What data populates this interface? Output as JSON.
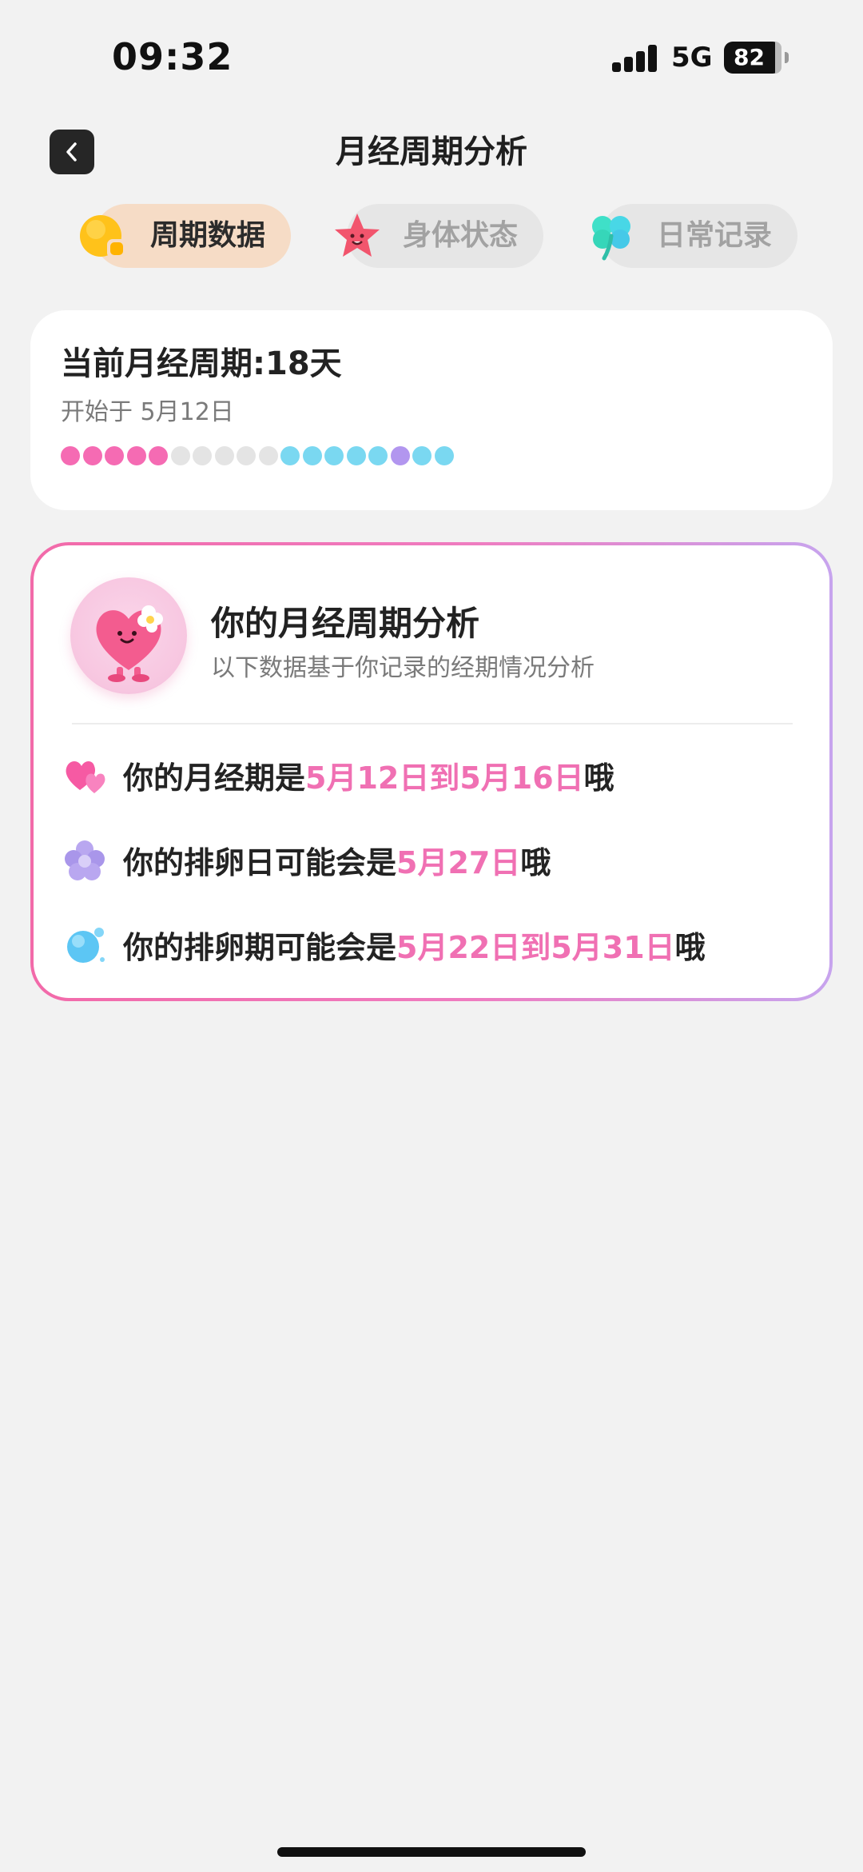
{
  "status_bar": {
    "time": "09:32",
    "network": "5G",
    "battery": "82",
    "signal_bars": 4
  },
  "header": {
    "back_icon": "chevron-left-icon",
    "title": "月经周期分析"
  },
  "tabs": [
    {
      "label": "周期数据",
      "icon": "sun-blob-icon",
      "active": true
    },
    {
      "label": "身体状态",
      "icon": "star-face-icon",
      "active": false
    },
    {
      "label": "日常记录",
      "icon": "clover-icon",
      "active": false
    }
  ],
  "current_cycle": {
    "title": "当前月经周期:18天",
    "start": "开始于 5月12日",
    "day_dots": [
      "period",
      "period",
      "period",
      "period",
      "period",
      "normal",
      "normal",
      "normal",
      "normal",
      "normal",
      "fertile",
      "fertile",
      "fertile",
      "fertile",
      "fertile",
      "ovulation",
      "fertile",
      "fertile"
    ],
    "colors": {
      "period": "#f56bb3",
      "normal": "#e4e4e4",
      "fertile": "#7ad8f1",
      "ovulation": "#b296ef"
    }
  },
  "analysis": {
    "avatar_icon": "heart-character-icon",
    "title": "你的月经周期分析",
    "subtitle": "以下数据基于你记录的经期情况分析",
    "items": [
      {
        "icon": "hearts-icon",
        "prefix": "你的月经期是",
        "highlight": "5月12日到5月16日",
        "suffix": "哦"
      },
      {
        "icon": "flower-icon",
        "prefix": "你的排卵日可能会是",
        "highlight": "5月27日",
        "suffix": "哦"
      },
      {
        "icon": "bubble-icon",
        "prefix": "你的排卵期可能会是",
        "highlight": "5月22日到5月31日",
        "suffix": "哦"
      }
    ],
    "highlight_color": "#f070b3"
  }
}
